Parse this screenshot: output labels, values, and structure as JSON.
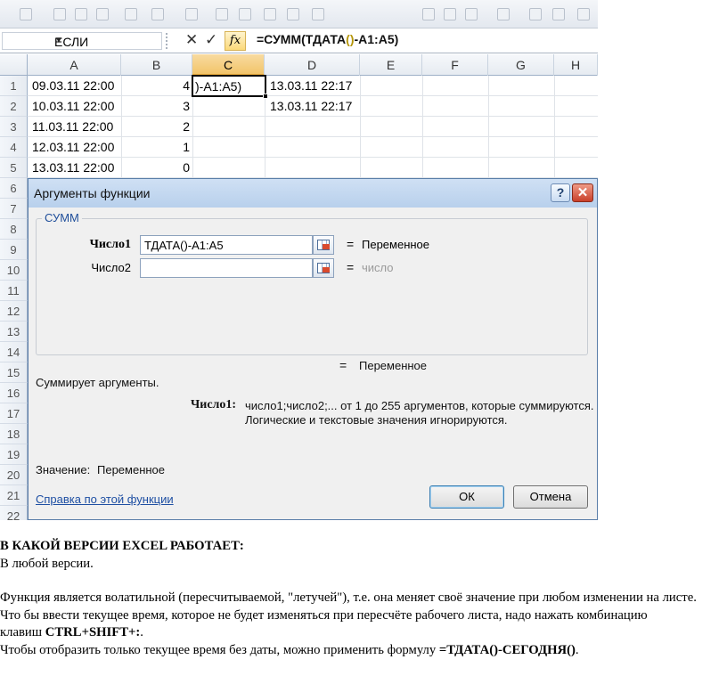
{
  "formula_bar": {
    "name_box": "ЕСЛИ",
    "cancel_symbol": "✕",
    "enter_symbol": "✓",
    "fx_label": "fx",
    "formula_before": "=СУММ(ТДАТА",
    "formula_paren": "()",
    "formula_after": "-A1:A5)"
  },
  "grid": {
    "columns": [
      "A",
      "B",
      "C",
      "D",
      "E",
      "F",
      "G",
      "H"
    ],
    "selected_column": "C",
    "rows": [
      "1",
      "2",
      "3",
      "4",
      "5",
      "6",
      "7",
      "8",
      "9",
      "10",
      "11",
      "12",
      "13",
      "14",
      "15",
      "16",
      "17",
      "18",
      "19",
      "20",
      "21",
      "22"
    ],
    "cells": {
      "A1": "09.03.11 22:00",
      "B1": "4",
      "C1": ")-A1:A5)",
      "D1": "13.03.11 22:17",
      "A2": "10.03.11 22:00",
      "B2": "3",
      "D2": "13.03.11 22:17",
      "A3": "11.03.11 22:00",
      "B3": "2",
      "A4": "12.03.11 22:00",
      "B4": "1",
      "A5": "13.03.11 22:00",
      "B5": "0"
    }
  },
  "dialog": {
    "title": "Аргументы функции",
    "help_symbol": "?",
    "close_symbol": "✕",
    "group_label": "СУММ",
    "arg1_label": "Число1",
    "arg1_value": "ТДАТА()-A1:A5",
    "arg1_result": "Переменное",
    "arg2_label": "Число2",
    "arg2_value": "",
    "arg2_result": "число",
    "equals": "=",
    "total_result": "Переменное",
    "description": "Суммирует аргументы.",
    "detail_label": "Число1:",
    "detail_line1": "число1;число2;... от 1 до 255 аргументов, которые суммируются.",
    "detail_line2": "Логические и текстовые значения игнорируются.",
    "value_label": "Значение:",
    "value": "Переменное",
    "help_link": "Справка по этой функции",
    "ok_label": "ОК",
    "cancel_label": "Отмена"
  },
  "document": {
    "heading": "В КАКОЙ ВЕРСИИ EXCEL РАБОТАЕТ:",
    "answer": "В любой версии.",
    "para1_line1": "Функция является волатильной (пересчитываемой, \"летучей\"), т.е. она меняет своё значение при любом изменении на листе.",
    "para1_line2": "Что бы ввести текущее время, которое не будет изменяться при пересчёте рабочего листа, надо нажать комбинацию",
    "para1_line3_prefix": "клавиш ",
    "shortcut": "CTRL+SHIFT+:",
    "para1_line3_suffix": ".",
    "para2_prefix": "Чтобы отобразить только текущее время без даты, можно применить формулу ",
    "formula": "=ТДАТА()-СЕГОДНЯ()",
    "para2_suffix": "."
  }
}
